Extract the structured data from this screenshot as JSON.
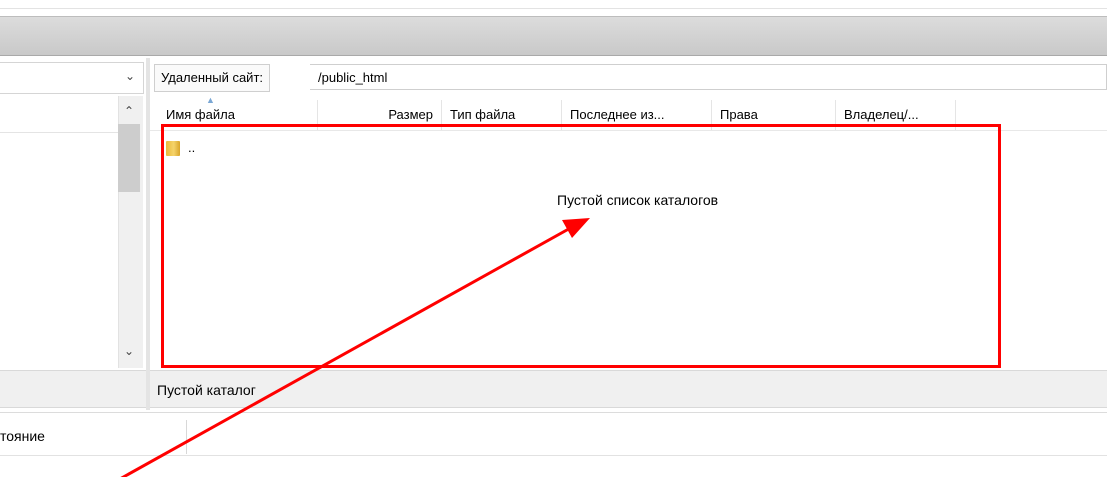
{
  "remote": {
    "label": "Удаленный сайт:",
    "path": "/public_html",
    "columns": [
      "Имя файла",
      "Размер",
      "Тип файла",
      "Последнее из...",
      "Права",
      "Владелец/..."
    ],
    "rows": [
      {
        "name": ".."
      }
    ],
    "empty_message": "Пустой список каталогов",
    "status": "Пустой каталог"
  },
  "queue": {
    "tab_label": "тояние"
  },
  "icons": {
    "folder": "folder-icon",
    "sort": "sort-arrow-icon",
    "dropdown": "chevron-down-icon",
    "scroll_up": "chevron-up-icon",
    "scroll_down": "chevron-down-icon"
  },
  "colors": {
    "annotation": "#ff0000",
    "toolbar": "#d3d3d3"
  }
}
